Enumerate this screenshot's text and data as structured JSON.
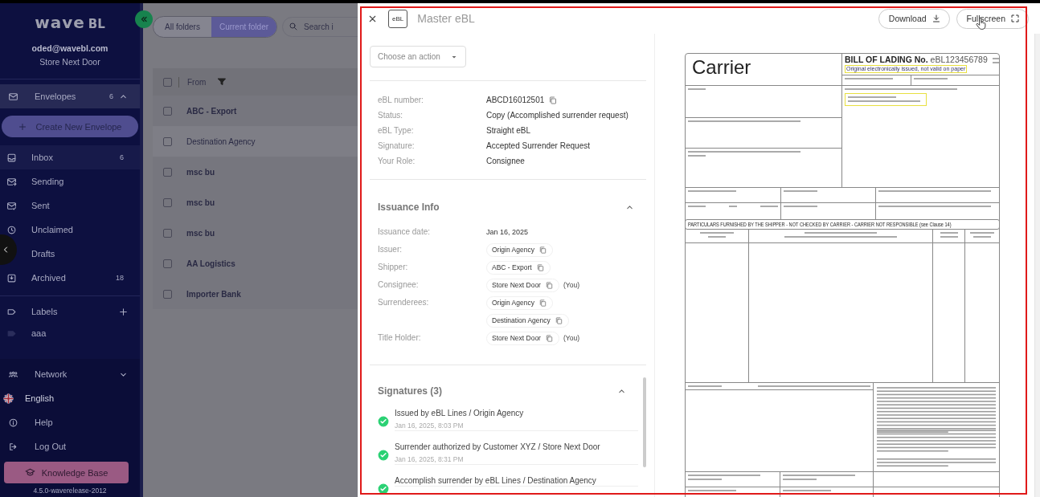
{
  "sidebar": {
    "logo": {
      "word": "wave",
      "suffix": "BL"
    },
    "account": {
      "email": "oded@wavebl.com",
      "organization": "Store Next Door"
    },
    "envelopes": {
      "label": "Envelopes",
      "count": "6",
      "expanded": true,
      "create_button": "Create New Envelope",
      "items": [
        {
          "label": "Inbox",
          "count": "6",
          "selected": true
        },
        {
          "label": "Sending",
          "selected": false
        },
        {
          "label": "Sent",
          "selected": false
        },
        {
          "label": "Unclaimed",
          "selected": false
        },
        {
          "label": "Drafts",
          "selected": false
        },
        {
          "label": "Archived",
          "count": "18",
          "selected": false
        }
      ]
    },
    "labels": {
      "label": "Labels",
      "items": [
        {
          "name": "aaa"
        }
      ]
    },
    "network": {
      "label": "Network",
      "expanded": false
    },
    "links": [
      {
        "label": "English"
      },
      {
        "label": "Help"
      },
      {
        "label": "Log Out"
      }
    ],
    "knowledge_base": "Knowledge Base",
    "version": "4.5.0-waverelease-2012"
  },
  "list": {
    "scope": [
      {
        "label": "All folders",
        "selected": false
      },
      {
        "label": "Current folder",
        "selected": true
      }
    ],
    "search": {
      "placeholder": "Search i"
    },
    "table": {
      "all_checked": false,
      "columns": [
        {
          "label": "From",
          "filter": true
        }
      ],
      "rows": [
        {
          "from": "ABC - Export",
          "unread": true,
          "checked": false
        },
        {
          "from": "Destination Agency",
          "unread": false,
          "checked": false
        },
        {
          "from": "msc bu",
          "unread": true,
          "checked": false
        },
        {
          "from": "msc bu",
          "unread": true,
          "checked": false
        },
        {
          "from": "msc bu",
          "unread": true,
          "checked": false
        },
        {
          "from": "AA Logistics",
          "unread": true,
          "checked": false
        },
        {
          "from": "Importer Bank",
          "unread": true,
          "checked": false
        }
      ]
    }
  },
  "drawer": {
    "badge": "eBL",
    "title": "Master eBL",
    "actions": [
      {
        "label": "Download"
      },
      {
        "label": "Fullscreen"
      }
    ],
    "action_select": {
      "placeholder": "Choose an action"
    },
    "details": [
      {
        "label": "eBL number:",
        "value": "ABCD16012501",
        "copyable": true
      },
      {
        "label": "Status:",
        "value": "Copy (Accomplished surrender request)",
        "copyable": false
      },
      {
        "label": "eBL Type:",
        "value": "Straight eBL",
        "copyable": false
      },
      {
        "label": "Signature:",
        "value": "Accepted Surrender Request",
        "copyable": false
      },
      {
        "label": "Your Role:",
        "value": "Consignee",
        "copyable": false
      }
    ],
    "issuance": {
      "title": "Issuance Info",
      "expanded": true,
      "fields": [
        {
          "label": "Issuance date:",
          "value": "Jan 16, 2025"
        },
        {
          "label": "Issuer:",
          "chips": [
            {
              "text": "Origin Agency"
            }
          ]
        },
        {
          "label": "Shipper:",
          "chips": [
            {
              "text": "ABC - Export"
            }
          ]
        },
        {
          "label": "Consignee:",
          "chips": [
            {
              "text": "Store Next Door",
              "note": "(You)"
            }
          ]
        },
        {
          "label": "Surrenderees:",
          "chips": [
            {
              "text": "Origin Agency"
            },
            {
              "text": "Destination Agency"
            }
          ]
        },
        {
          "label": "Title Holder:",
          "chips": [
            {
              "text": "Store Next Door",
              "note": "(You)"
            }
          ]
        }
      ]
    },
    "signatures": {
      "title": "Signatures (3)",
      "expanded": true,
      "items": [
        {
          "text": "Issued by eBL Lines / Origin Agency",
          "time": "Jan 16, 2025, 8:03 PM",
          "signed": true
        },
        {
          "text": "Surrender authorized by Customer XYZ / Store Next Door",
          "time": "Jan 16, 2025, 8:31 PM",
          "signed": true
        },
        {
          "text": "Accomplish surrender by eBL Lines / Destination Agency",
          "signed": true
        }
      ]
    }
  },
  "document": {
    "carrier": "Carrier",
    "title": "BILL OF LADING No.",
    "number": "eBL123456789",
    "notice": "Original electronically issued, not valid on paper",
    "particulars": "PARTICULARS FURNISHED BY THE SHIPPER - NOT CHECKED BY CARRIER - CARRIER NOT RESPONSIBLE",
    "particulars_note": "(see Clause 14)"
  }
}
